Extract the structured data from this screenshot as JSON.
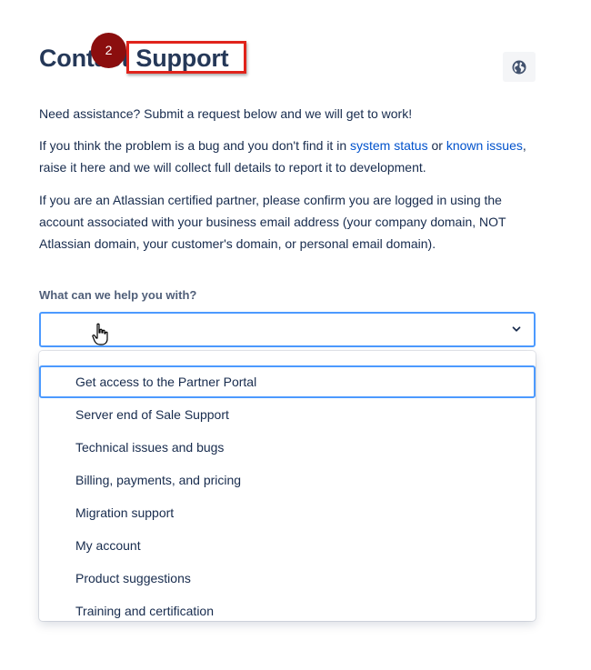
{
  "page": {
    "title": "Contact Support",
    "step_number": "2",
    "intro": "Need assistance? Submit a request below and we will get to work!",
    "bug_text_before": "If you think the problem is a bug and you don't find it in ",
    "system_status_link": "system status",
    "or_text": " or ",
    "known_issues_link": "known issues",
    "bug_text_after": ", raise it here and we will collect full details to report it to development.",
    "partner_text": "If you are an Atlassian certified partner, please confirm you are logged in using the account associated with your business email address (your company domain, NOT Atlassian domain, your customer's domain, or personal email domain)."
  },
  "form": {
    "label": "What can we help you with?",
    "selected_value": "",
    "options": [
      "Get access to the Partner Portal",
      "Server end of Sale Support",
      "Technical issues and bugs",
      "Billing, payments, and pricing",
      "Migration support",
      "My account",
      "Product suggestions",
      "Training and certification"
    ],
    "focused_option_index": 0
  },
  "icons": {
    "language": "globe-icon",
    "dropdown": "chevron-down-icon",
    "cursor": "hand-pointer-icon"
  },
  "colors": {
    "link": "#0052cc",
    "focus": "#4c9aff",
    "highlight": "#e0231b",
    "step_badge": "#8b0e0e"
  }
}
